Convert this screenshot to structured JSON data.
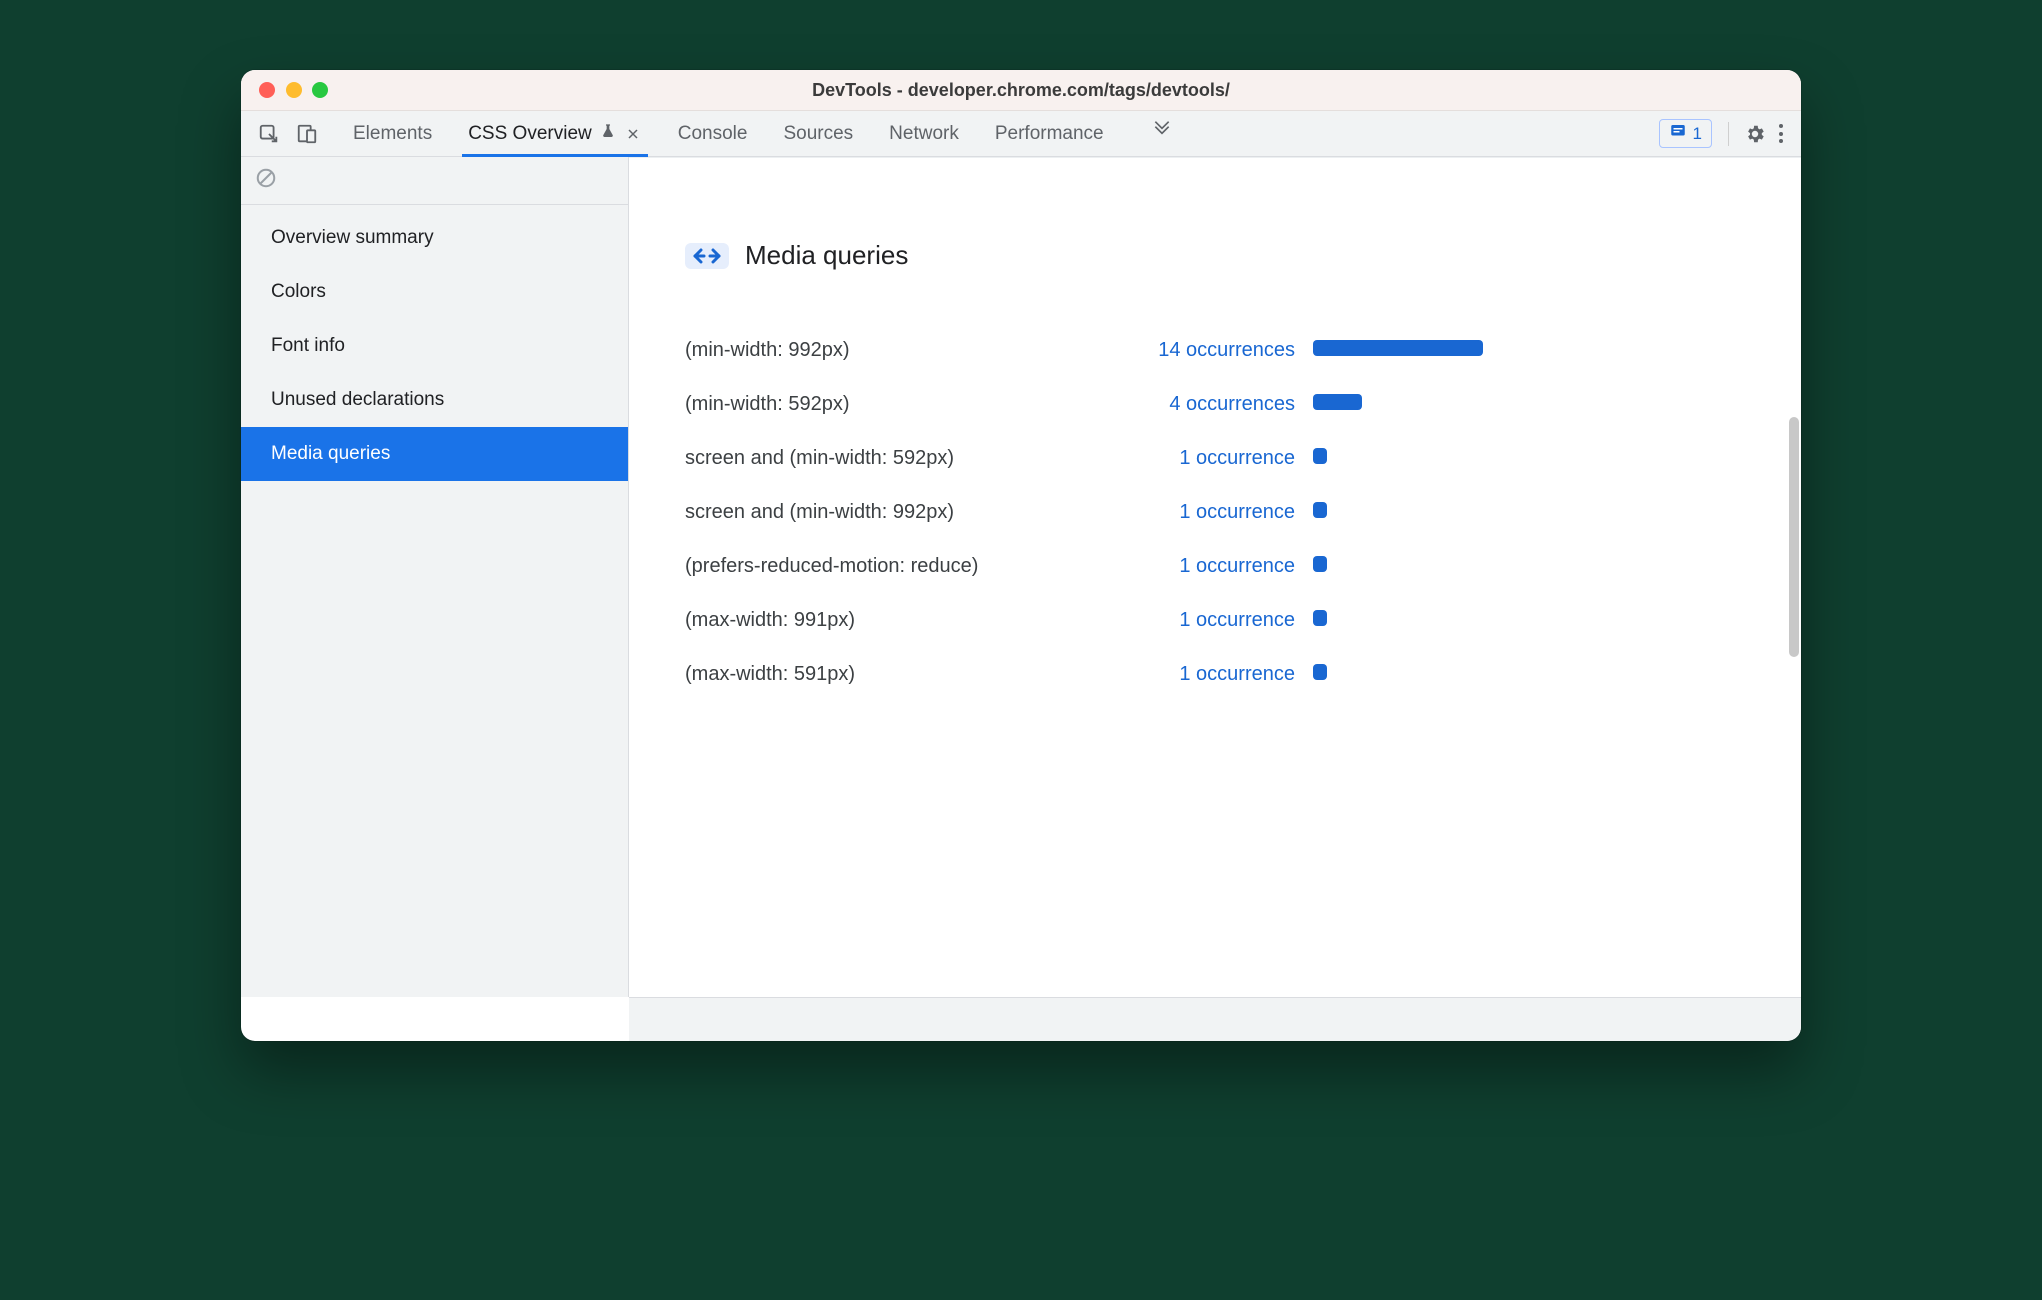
{
  "colors": {
    "blue": "#1a73e8"
  },
  "window": {
    "title": "DevTools - developer.chrome.com/tags/devtools/"
  },
  "toolbar": {
    "tabs": {
      "elements": "Elements",
      "cssoverview": "CSS Overview",
      "console": "Console",
      "sources": "Sources",
      "network": "Network",
      "performance": "Performance"
    },
    "issues_count": "1"
  },
  "sidebar": {
    "items": [
      {
        "label": "Overview summary"
      },
      {
        "label": "Colors"
      },
      {
        "label": "Font info"
      },
      {
        "label": "Unused declarations"
      },
      {
        "label": "Media queries"
      }
    ]
  },
  "section": {
    "title": "Media queries",
    "occurrence_word_singular": "occurrence",
    "occurrence_word_plural": "occurrences"
  },
  "chart_data": {
    "type": "bar",
    "title": "Media queries",
    "xlabel": "",
    "ylabel": "occurrences",
    "categories": [
      "(min-width: 992px)",
      "(min-width: 592px)",
      "screen and (min-width: 592px)",
      "screen and (min-width: 992px)",
      "(prefers-reduced-motion: reduce)",
      "(max-width: 991px)",
      "(max-width: 591px)"
    ],
    "values": [
      14,
      4,
      1,
      1,
      1,
      1,
      1
    ]
  }
}
